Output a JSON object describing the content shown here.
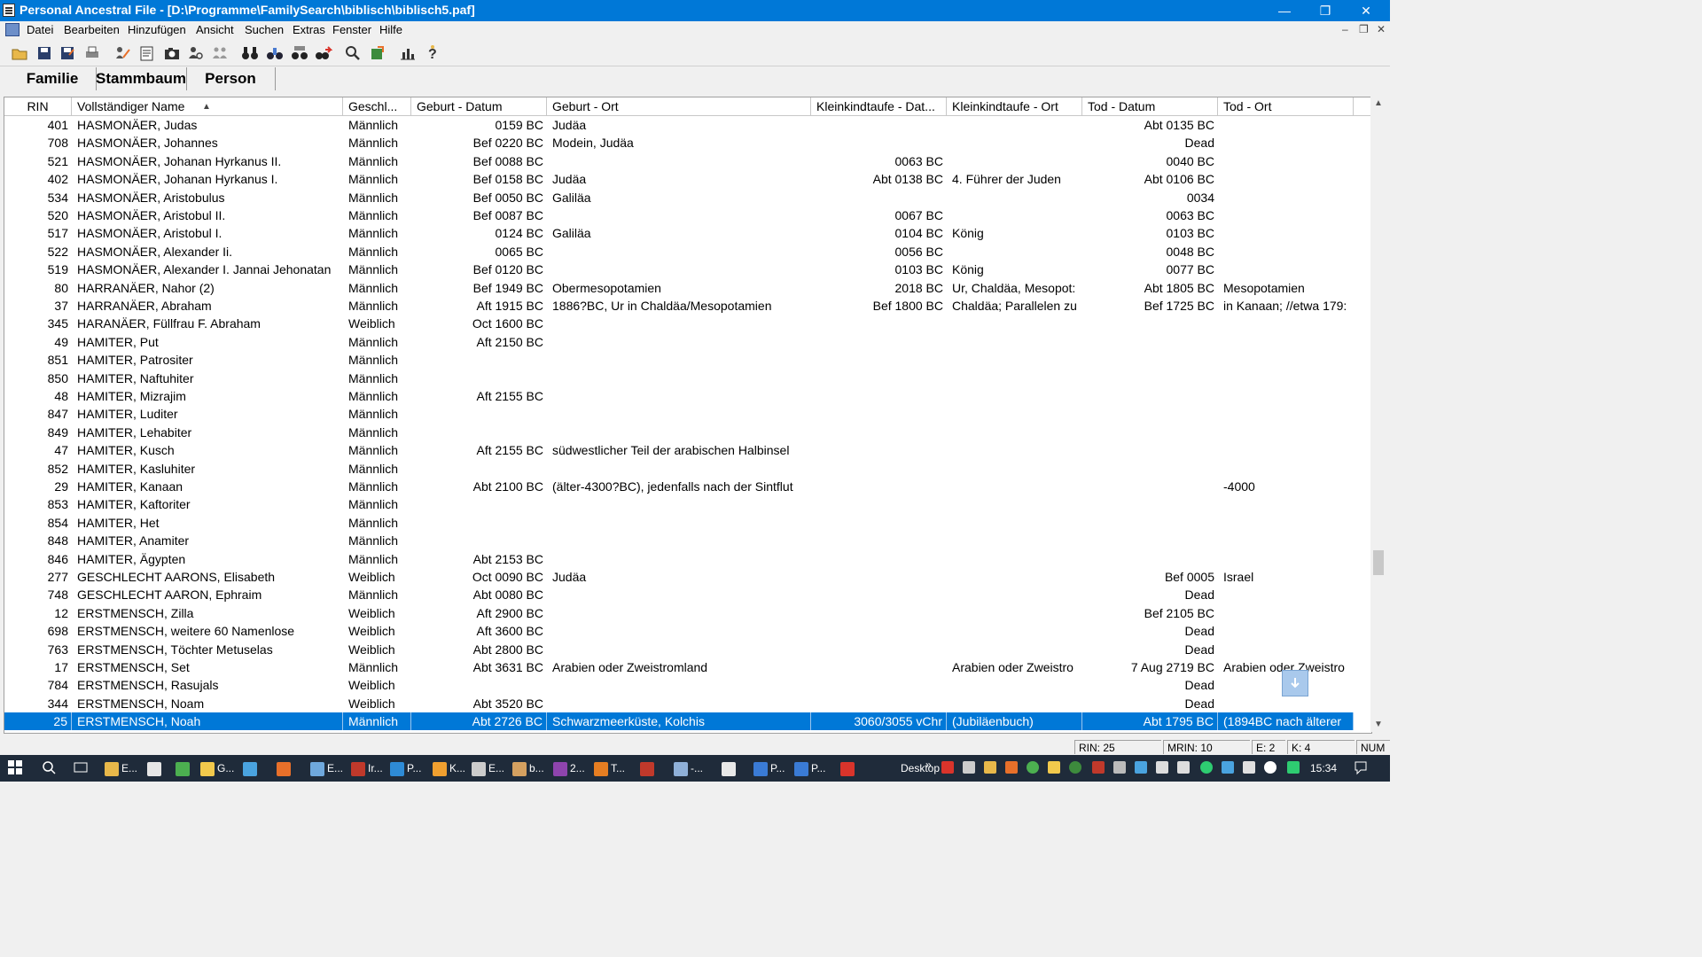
{
  "window": {
    "title": "Personal Ancestral File - [D:\\Programme\\FamilySearch\\biblisch\\biblisch5.paf]",
    "minimize": "—",
    "maximize": "❐",
    "close": "✕"
  },
  "menu": [
    "Datei",
    "Bearbeiten",
    "Hinzufügen",
    "Ansicht",
    "Suchen",
    "Extras",
    "Fenster",
    "Hilfe"
  ],
  "mdi_controls": [
    "–",
    "❐",
    "✕"
  ],
  "toolbar_icons": [
    "open-folder-icon",
    "save-icon",
    "save-as-icon",
    "print-icon",
    "edit-individual-icon",
    "edit-notes-icon",
    "camera-icon",
    "search-person-icon",
    "merge-icon",
    "binoculars-icon",
    "find-icon",
    "find-duplicates-icon",
    "advanced-search-icon",
    "research-icon",
    "export-icon",
    "statistics-icon",
    "help-icon"
  ],
  "tabs": [
    "Familie",
    "Stammbaum",
    "Person"
  ],
  "columns": [
    "RIN",
    "Vollständiger Name",
    "Geschl...",
    "Geburt - Datum",
    "Geburt - Ort",
    "Kleinkindtaufe - Dat...",
    "Kleinkindtaufe - Ort",
    "Tod - Datum",
    "Tod - Ort"
  ],
  "sort_indicator": "▲",
  "rows": [
    {
      "rin": "401",
      "name": "HASMONÄER, Judas",
      "sex": "Männlich",
      "bdate": "0159 BC",
      "bplace": "Judäa",
      "cdate": "",
      "cplace": "",
      "ddate": "Abt 0135 BC",
      "dplace": ""
    },
    {
      "rin": "708",
      "name": "HASMONÄER, Johannes",
      "sex": "Männlich",
      "bdate": "Bef 0220 BC",
      "bplace": "Modein, Judäa",
      "cdate": "",
      "cplace": "",
      "ddate": "Dead",
      "dplace": ""
    },
    {
      "rin": "521",
      "name": "HASMONÄER, Johanan Hyrkanus II.",
      "sex": "Männlich",
      "bdate": "Bef 0088 BC",
      "bplace": "",
      "cdate": "0063 BC",
      "cplace": "",
      "ddate": "0040 BC",
      "dplace": ""
    },
    {
      "rin": "402",
      "name": "HASMONÄER, Johanan Hyrkanus I.",
      "sex": "Männlich",
      "bdate": "Bef 0158 BC",
      "bplace": "Judäa",
      "cdate": "Abt 0138 BC",
      "cplace": "4. Führer der Juden",
      "ddate": "Abt 0106 BC",
      "dplace": ""
    },
    {
      "rin": "534",
      "name": "HASMONÄER, Aristobulus",
      "sex": "Männlich",
      "bdate": "Bef 0050 BC",
      "bplace": "Galiläa",
      "cdate": "",
      "cplace": "",
      "ddate": "0034",
      "dplace": ""
    },
    {
      "rin": "520",
      "name": "HASMONÄER, Aristobul II.",
      "sex": "Männlich",
      "bdate": "Bef 0087 BC",
      "bplace": "",
      "cdate": "0067 BC",
      "cplace": "",
      "ddate": "0063 BC",
      "dplace": ""
    },
    {
      "rin": "517",
      "name": "HASMONÄER, Aristobul I.",
      "sex": "Männlich",
      "bdate": "0124 BC",
      "bplace": "Galiläa",
      "cdate": "0104 BC",
      "cplace": "König",
      "ddate": "0103 BC",
      "dplace": ""
    },
    {
      "rin": "522",
      "name": "HASMONÄER, Alexander Ii.",
      "sex": "Männlich",
      "bdate": "0065 BC",
      "bplace": "",
      "cdate": "0056 BC",
      "cplace": "",
      "ddate": "0048 BC",
      "dplace": ""
    },
    {
      "rin": "519",
      "name": "HASMONÄER, Alexander I. Jannai Jehonatan",
      "sex": "Männlich",
      "bdate": "Bef 0120 BC",
      "bplace": "",
      "cdate": "0103 BC",
      "cplace": "König",
      "ddate": "0077 BC",
      "dplace": ""
    },
    {
      "rin": "80",
      "name": "HARRANÄER, Nahor (2)",
      "sex": "Männlich",
      "bdate": "Bef 1949 BC",
      "bplace": "Obermesopotamien",
      "cdate": "2018 BC",
      "cplace": "Ur, Chaldäa, Mesopot:",
      "ddate": "Abt 1805 BC",
      "dplace": "Mesopotamien"
    },
    {
      "rin": "37",
      "name": "HARRANÄER, Abraham",
      "sex": "Männlich",
      "bdate": "Aft 1915 BC",
      "bplace": "1886?BC, Ur in Chaldäa/Mesopotamien",
      "cdate": "Bef 1800 BC",
      "cplace": "Chaldäa; Parallelen zu",
      "ddate": "Bef 1725 BC",
      "dplace": "in Kanaan; //etwa 179:"
    },
    {
      "rin": "345",
      "name": "HARANÄER, Füllfrau F. Abraham",
      "sex": "Weiblich",
      "bdate": "Oct 1600 BC",
      "bplace": "",
      "cdate": "",
      "cplace": "",
      "ddate": "",
      "dplace": ""
    },
    {
      "rin": "49",
      "name": "HAMITER, Put",
      "sex": "Männlich",
      "bdate": "Aft 2150 BC",
      "bplace": "",
      "cdate": "",
      "cplace": "",
      "ddate": "",
      "dplace": ""
    },
    {
      "rin": "851",
      "name": "HAMITER, Patrositer",
      "sex": "Männlich",
      "bdate": "",
      "bplace": "",
      "cdate": "",
      "cplace": "",
      "ddate": "",
      "dplace": ""
    },
    {
      "rin": "850",
      "name": "HAMITER, Naftuhiter",
      "sex": "Männlich",
      "bdate": "",
      "bplace": "",
      "cdate": "",
      "cplace": "",
      "ddate": "",
      "dplace": ""
    },
    {
      "rin": "48",
      "name": "HAMITER, Mizrajim",
      "sex": "Männlich",
      "bdate": "Aft 2155 BC",
      "bplace": "",
      "cdate": "",
      "cplace": "",
      "ddate": "",
      "dplace": ""
    },
    {
      "rin": "847",
      "name": "HAMITER, Luditer",
      "sex": "Männlich",
      "bdate": "",
      "bplace": "",
      "cdate": "",
      "cplace": "",
      "ddate": "",
      "dplace": ""
    },
    {
      "rin": "849",
      "name": "HAMITER, Lehabiter",
      "sex": "Männlich",
      "bdate": "",
      "bplace": "",
      "cdate": "",
      "cplace": "",
      "ddate": "",
      "dplace": ""
    },
    {
      "rin": "47",
      "name": "HAMITER, Kusch",
      "sex": "Männlich",
      "bdate": "Aft 2155 BC",
      "bplace": "südwestlicher Teil der arabischen Halbinsel",
      "cdate": "",
      "cplace": "",
      "ddate": "",
      "dplace": ""
    },
    {
      "rin": "852",
      "name": "HAMITER, Kasluhiter",
      "sex": "Männlich",
      "bdate": "",
      "bplace": "",
      "cdate": "",
      "cplace": "",
      "ddate": "",
      "dplace": ""
    },
    {
      "rin": "29",
      "name": "HAMITER, Kanaan",
      "sex": "Männlich",
      "bdate": "Abt 2100 BC",
      "bplace": "(älter-4300?BC), jedenfalls  nach der Sintflut",
      "cdate": "",
      "cplace": "",
      "ddate": "",
      "dplace": "-4000"
    },
    {
      "rin": "853",
      "name": "HAMITER, Kaftoriter",
      "sex": "Männlich",
      "bdate": "",
      "bplace": "",
      "cdate": "",
      "cplace": "",
      "ddate": "",
      "dplace": ""
    },
    {
      "rin": "854",
      "name": "HAMITER, Het",
      "sex": "Männlich",
      "bdate": "",
      "bplace": "",
      "cdate": "",
      "cplace": "",
      "ddate": "",
      "dplace": ""
    },
    {
      "rin": "848",
      "name": "HAMITER, Anamiter",
      "sex": "Männlich",
      "bdate": "",
      "bplace": "",
      "cdate": "",
      "cplace": "",
      "ddate": "",
      "dplace": ""
    },
    {
      "rin": "846",
      "name": "HAMITER, Ägypten",
      "sex": "Männlich",
      "bdate": "Abt 2153 BC",
      "bplace": "",
      "cdate": "",
      "cplace": "",
      "ddate": "",
      "dplace": ""
    },
    {
      "rin": "277",
      "name": "GESCHLECHT AARONS, Elisabeth",
      "sex": "Weiblich",
      "bdate": "Oct 0090 BC",
      "bplace": "Judäa",
      "cdate": "",
      "cplace": "",
      "ddate": "Bef 0005",
      "dplace": "Israel"
    },
    {
      "rin": "748",
      "name": "GESCHLECHT AARON, Ephraim",
      "sex": "Männlich",
      "bdate": "Abt 0080 BC",
      "bplace": "",
      "cdate": "",
      "cplace": "",
      "ddate": "Dead",
      "dplace": ""
    },
    {
      "rin": "12",
      "name": "ERSTMENSCH, Zilla",
      "sex": "Weiblich",
      "bdate": "Aft 2900 BC",
      "bplace": "",
      "cdate": "",
      "cplace": "",
      "ddate": "Bef 2105 BC",
      "dplace": ""
    },
    {
      "rin": "698",
      "name": "ERSTMENSCH, weitere 60 Namenlose",
      "sex": "Weiblich",
      "bdate": "Aft 3600 BC",
      "bplace": "",
      "cdate": "",
      "cplace": "",
      "ddate": "Dead",
      "dplace": ""
    },
    {
      "rin": "763",
      "name": "ERSTMENSCH, Töchter Metuselas",
      "sex": "Weiblich",
      "bdate": "Abt 2800 BC",
      "bplace": "",
      "cdate": "",
      "cplace": "",
      "ddate": "Dead",
      "dplace": ""
    },
    {
      "rin": "17",
      "name": "ERSTMENSCH, Set",
      "sex": "Männlich",
      "bdate": "Abt 3631 BC",
      "bplace": "Arabien oder Zweistromland",
      "cdate": "",
      "cplace": "Arabien oder Zweistro",
      "ddate": "7 Aug 2719 BC",
      "dplace": "Arabien oder Zweistro"
    },
    {
      "rin": "784",
      "name": "ERSTMENSCH, Rasujals",
      "sex": "Weiblich",
      "bdate": "",
      "bplace": "",
      "cdate": "",
      "cplace": "",
      "ddate": "Dead",
      "dplace": ""
    },
    {
      "rin": "344",
      "name": "ERSTMENSCH, Noam",
      "sex": "Weiblich",
      "bdate": "Abt 3520 BC",
      "bplace": "",
      "cdate": "",
      "cplace": "",
      "ddate": "Dead",
      "dplace": ""
    },
    {
      "rin": "25",
      "name": "ERSTMENSCH, Noah",
      "sex": "Männlich",
      "bdate": "Abt 2726 BC",
      "bplace": "Schwarzmeerküste, Kolchis",
      "cdate": "3060/3055 vChr",
      "cplace": "(Jubiläenbuch)",
      "ddate": "Abt 1795 BC",
      "dplace": "(1894BC nach älterer",
      "selected": true
    }
  ],
  "status": [
    "RIN: 25",
    "MRIN: 10",
    "E: 2",
    "K: 4",
    "NUM"
  ],
  "taskbar": {
    "items": [
      "E...",
      "",
      "",
      "G...",
      "",
      "",
      "E...",
      "Ir...",
      "P...",
      "K...",
      "E...",
      "b...",
      "2...",
      "T...",
      "",
      "-...",
      "",
      "P...",
      "P...",
      ""
    ],
    "item_colors": [
      "#e8b84a",
      "#e6e6e6",
      "#4caf50",
      "#f2c94c",
      "#4aa3df",
      "#e8702a",
      "#6fa8dc",
      "#c0392b",
      "#2e8bd6",
      "#f0a030",
      "#cccccc",
      "#d4a060",
      "#8e44ad",
      "#e67e22",
      "#c0392b",
      "#8fb0d8",
      "#e8e8e8",
      "#3a7bd5",
      "#3a7bd5",
      "#d9342b"
    ],
    "desktop_label": "Desktop",
    "chevron": "»",
    "time": "15:34"
  }
}
